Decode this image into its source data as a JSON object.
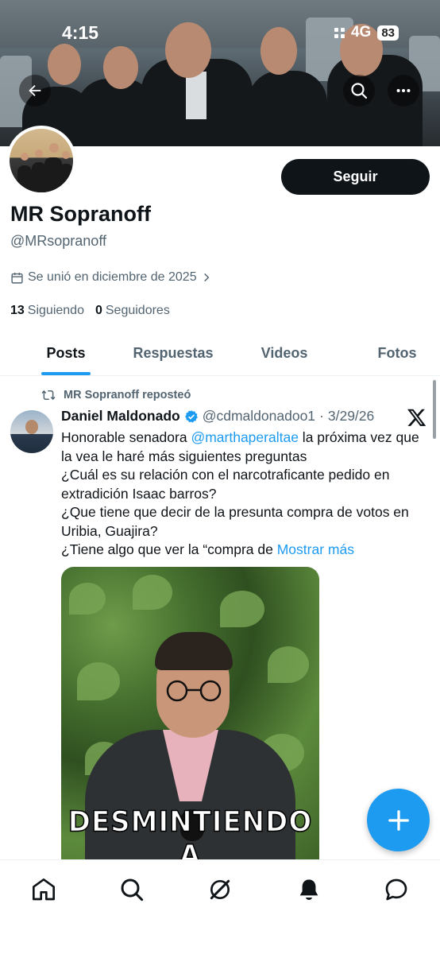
{
  "status_bar": {
    "time": "4:15",
    "network": "4G",
    "battery": "83"
  },
  "profile": {
    "display_name": "MR Sopranoff",
    "handle": "@MRsopranoff",
    "joined": "Se unió en diciembre de 2025",
    "following_count": "13",
    "following_label": "Siguiendo",
    "followers_count": "0",
    "followers_label": "Seguidores",
    "follow_button": "Seguir"
  },
  "tabs": [
    {
      "label": "Posts",
      "active": true
    },
    {
      "label": "Respuestas",
      "active": false
    },
    {
      "label": "Videos",
      "active": false
    },
    {
      "label": "Fotos",
      "active": false
    }
  ],
  "post": {
    "repost_label": "MR Sopranoff reposteó",
    "author": "Daniel Maldonado",
    "verified": true,
    "author_handle": "@cdmaldonadoo1",
    "separator": "·",
    "date": "3/29/26",
    "text_line1_before": "Honorable senadora ",
    "mention": "@marthaperaltae",
    "text_line1_after": " la próxima vez que la vea le haré más siguientes preguntas",
    "text_line2": "¿Cuál es su relación con el narcotraficante pedido en extradición Isaac barros?",
    "text_line3": "¿Que tiene que decir de la presunta compra de votos en Uribia, Guajira?",
    "text_line4": "¿Tiene algo que ver la “compra de ",
    "show_more": "Mostrar más",
    "media_caption": "DESMINTIENDO A"
  },
  "icons": {
    "back": "arrow-left-icon",
    "search": "search-icon",
    "more": "more-horizontal-icon",
    "calendar": "calendar-icon",
    "repost": "repost-icon",
    "verified": "verified-badge-icon",
    "x_logo": "x-logo-icon",
    "compose": "plus-icon",
    "nav": [
      "home-icon",
      "search-icon",
      "grok-icon",
      "bell-icon",
      "messages-icon"
    ]
  },
  "colors": {
    "accent": "#1d9bf0",
    "text": "#0f1419",
    "secondary": "#536471"
  }
}
